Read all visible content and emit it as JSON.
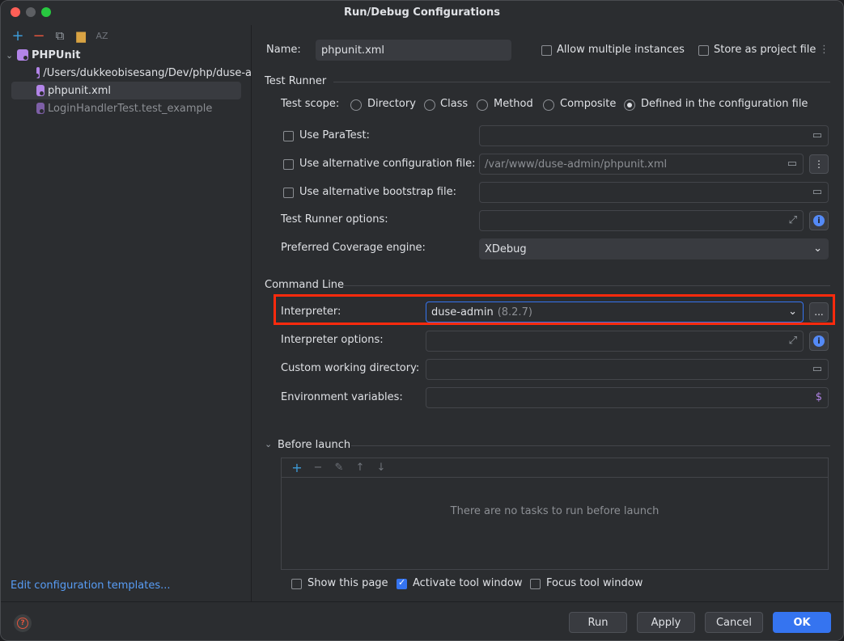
{
  "window": {
    "title": "Run/Debug Configurations"
  },
  "left_toolbar": [
    "add-icon",
    "remove-icon",
    "copy-icon",
    "folder-icon",
    "sort-icon"
  ],
  "tree": {
    "root": "PHPUnit",
    "items": [
      {
        "label": "/Users/dukkeobisesang/Dev/php/duse-a"
      },
      {
        "label": "phpunit.xml"
      },
      {
        "label": "LoginHandlerTest.test_example"
      }
    ]
  },
  "edit_templates_link": "Edit configuration templates...",
  "config": {
    "name_label": "Name:",
    "name_value": "phpunit.xml",
    "allow_multiple": "Allow multiple instances",
    "store_as_project": "Store as project file",
    "more_icon": "⋮"
  },
  "test_runner": {
    "section": "Test Runner",
    "scope_label": "Test scope:",
    "scopes": [
      "Directory",
      "Class",
      "Method",
      "Composite",
      "Defined in the configuration file"
    ],
    "selected_scope": "Defined in the configuration file",
    "use_paratest": "Use ParaTest:",
    "use_alt_config": "Use alternative configuration file:",
    "alt_config_value": "/var/www/duse-admin/phpunit.xml",
    "use_alt_bootstrap": "Use alternative bootstrap file:",
    "runner_options_label": "Test Runner options:",
    "coverage_label": "Preferred Coverage engine:",
    "coverage_value": "XDebug"
  },
  "command_line": {
    "section": "Command Line",
    "interpreter_label": "Interpreter:",
    "interpreter_value": "duse-admin",
    "interpreter_version": "(8.2.7)",
    "interpreter_browse": "...",
    "options_label": "Interpreter options:",
    "workdir_label": "Custom working directory:",
    "env_label": "Environment variables:"
  },
  "before_launch": {
    "section": "Before launch",
    "empty_message": "There are no tasks to run before launch",
    "show_page": "Show this page",
    "activate_tool_window": "Activate tool window",
    "focus_tool_window": "Focus tool window"
  },
  "buttons": {
    "run": "Run",
    "apply": "Apply",
    "cancel": "Cancel",
    "ok": "OK"
  },
  "colors": {
    "accent": "#3574f0",
    "highlight": "#ff2a0d",
    "link": "#589df6"
  }
}
